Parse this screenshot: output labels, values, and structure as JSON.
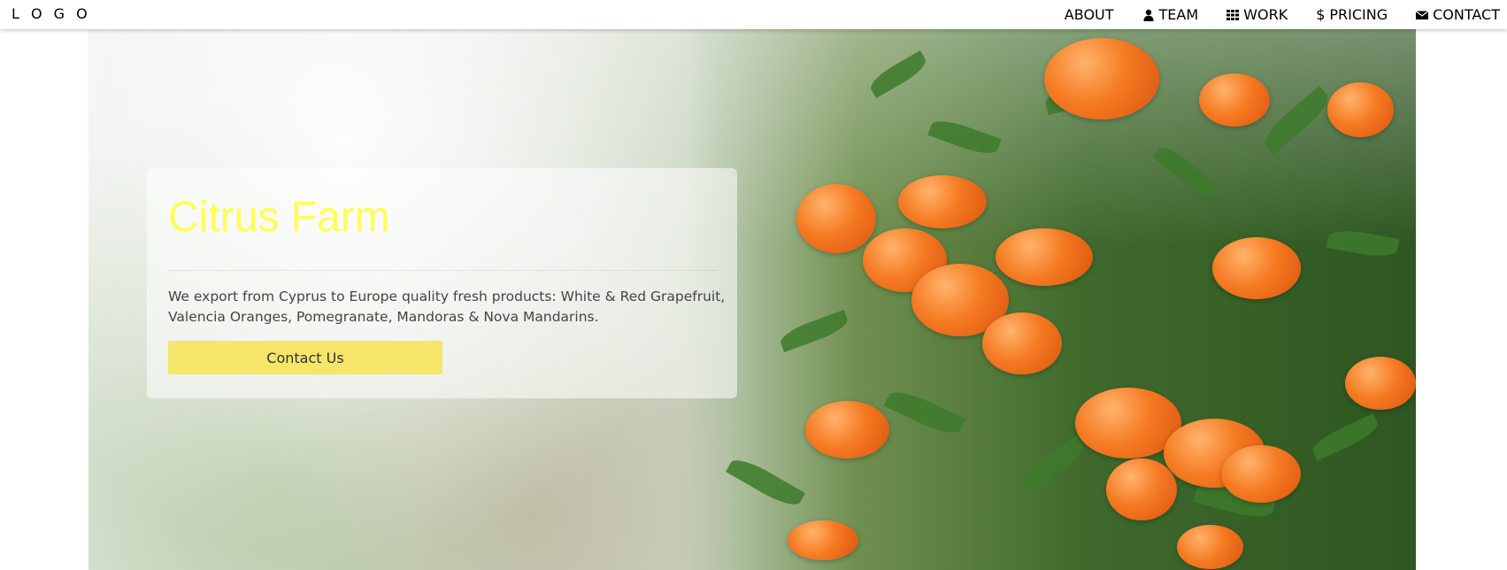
{
  "header": {
    "logo": "L O G O",
    "nav": [
      {
        "label": "ABOUT",
        "icon": ""
      },
      {
        "label": "TEAM",
        "icon": "user-icon"
      },
      {
        "label": "WORK",
        "icon": "grid-icon"
      },
      {
        "label": "PRICING",
        "icon": "dollar-icon"
      },
      {
        "label": "CONTACT",
        "icon": "envelope-icon"
      }
    ]
  },
  "hero": {
    "title": "Citrus Farm",
    "description": "We export from Cyprus to Europe quality fresh products: White & Red Grapefruit, Valencia Oranges, Pomegranate, Mandoras & Nova Mandarins.",
    "button_label": "Contact Us"
  },
  "colors": {
    "title": "#ffff55",
    "button": "#f5e66b",
    "nav_text": "#000000"
  }
}
